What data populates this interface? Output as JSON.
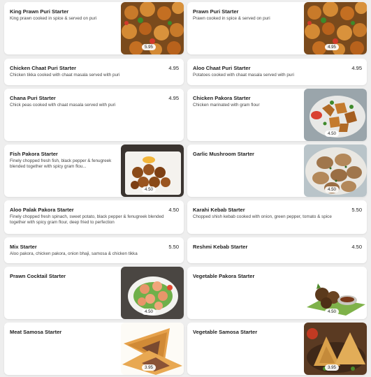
{
  "menu": {
    "items": [
      {
        "title": "King Prawn Puri Starter",
        "desc": "King prawn cooked in spice & served on puri",
        "price": "5.95"
      },
      {
        "title": "Prawn Puri Starter",
        "desc": "Prawn cooked in spice & served on puri",
        "price": "4.95"
      },
      {
        "title": "Chicken Chaat Puri Starter",
        "desc": "Chicken tikka cooked with chaat masala served with puri",
        "price": "4.95"
      },
      {
        "title": "Aloo Chaat Puri Starter",
        "desc": "Potatoes cooked with chaat masala served with puri",
        "price": "4.95"
      },
      {
        "title": "Chana Puri Starter",
        "desc": "Chick peas cooked with chaat masala served with puri",
        "price": "4.95"
      },
      {
        "title": "Chicken Pakora Starter",
        "desc": "Chicken marinated with gram flour",
        "price": "4.50"
      },
      {
        "title": "Fish Pakora Starter",
        "desc": "Finely chopped fresh fish, black pepper & fenugreek blended together with spicy gram flou...",
        "price": "4.50"
      },
      {
        "title": "Garlic Mushroom Starter",
        "desc": "",
        "price": "4.50"
      },
      {
        "title": "Aloo Palak Pakora Starter",
        "desc": "Finely chopped fresh spinach, sweet potato, black pepper & fenugreek blended together with spicy gram flour, deep fried to perfection",
        "price": "4.50"
      },
      {
        "title": "Karahi Kebab Starter",
        "desc": "Chopped shish kebab cooked with onion, green pepper, tomato & spice",
        "price": "5.50"
      },
      {
        "title": "Mix Starter",
        "desc": "Aloo pakora, chicken pakora, onion bhaji, samosa & chicken tikka",
        "price": "5.50"
      },
      {
        "title": "Reshmi Kebab Starter",
        "desc": "",
        "price": "4.50"
      },
      {
        "title": "Prawn Cocktail Starter",
        "desc": "",
        "price": "4.50"
      },
      {
        "title": "Vegetable Pakora Starter",
        "desc": "",
        "price": "4.50"
      },
      {
        "title": "Meat Samosa Starter",
        "desc": "",
        "price": "3.95"
      },
      {
        "title": "Vegetable Samosa Starter",
        "desc": "",
        "price": "3.95"
      }
    ]
  }
}
